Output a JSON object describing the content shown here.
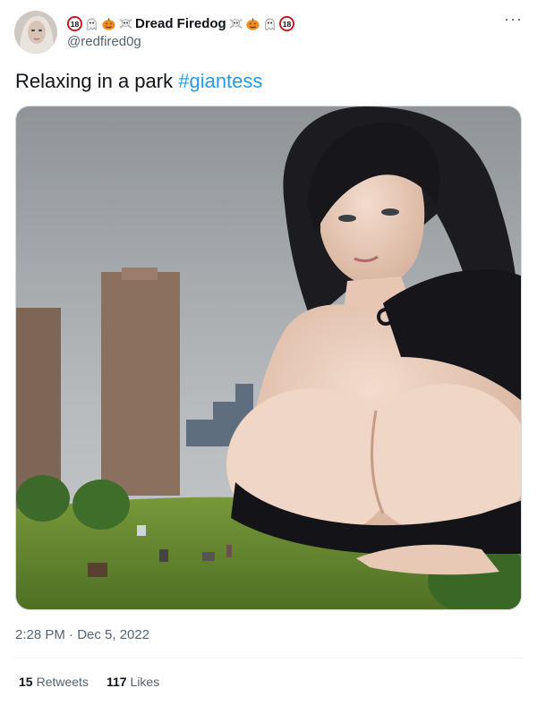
{
  "author": {
    "display_name": "Dread Firedog",
    "handle": "@redfired0g",
    "leading_emojis": [
      "18-badge-icon",
      "ghost-icon",
      "pumpkin-icon",
      "skull-crossbones-icon"
    ],
    "trailing_emojis": [
      "skull-crossbones-icon",
      "pumpkin-icon",
      "ghost-icon",
      "18-badge-icon"
    ]
  },
  "tweet": {
    "text": "Relaxing in a park ",
    "hashtag": "#giantess",
    "timestamp": "2:28 PM · Dec 5, 2022"
  },
  "stats": {
    "retweets_count": "15",
    "retweets_label": "Retweets",
    "likes_count": "117",
    "likes_label": "Likes"
  },
  "colors": {
    "link": "#1d9bf0",
    "secondary_text": "#536471",
    "primary_text": "#0f1419"
  }
}
